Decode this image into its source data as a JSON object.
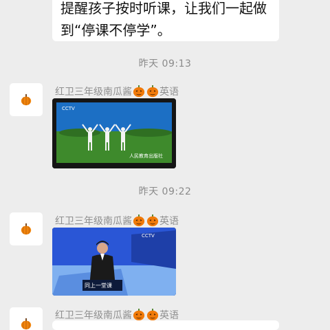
{
  "messages": {
    "first": {
      "line1": "提醒孩子按时听课，让我们一起做",
      "line2": "到“停课不停学”。"
    },
    "time1": "昨天 09:13",
    "time2": "昨天 09:22",
    "sender": {
      "name_prefix": "红卫三年级南瓜酱",
      "name_suffix": "英语"
    },
    "tv1": {
      "channel_logo": "CCTV",
      "watermark": "人民教育出版社"
    },
    "tv2": {
      "channel_logo": "CCTV",
      "caption": "同上一堂课"
    }
  },
  "icons": {
    "avatar": "pumpkin-icon",
    "emoji": "jack-o-lantern-icon"
  },
  "colors": {
    "background": "#ededed",
    "bubble": "#ffffff",
    "sky": "#1c6fc4",
    "grass": "#3e8a2c",
    "studio": "#2a56d6"
  }
}
